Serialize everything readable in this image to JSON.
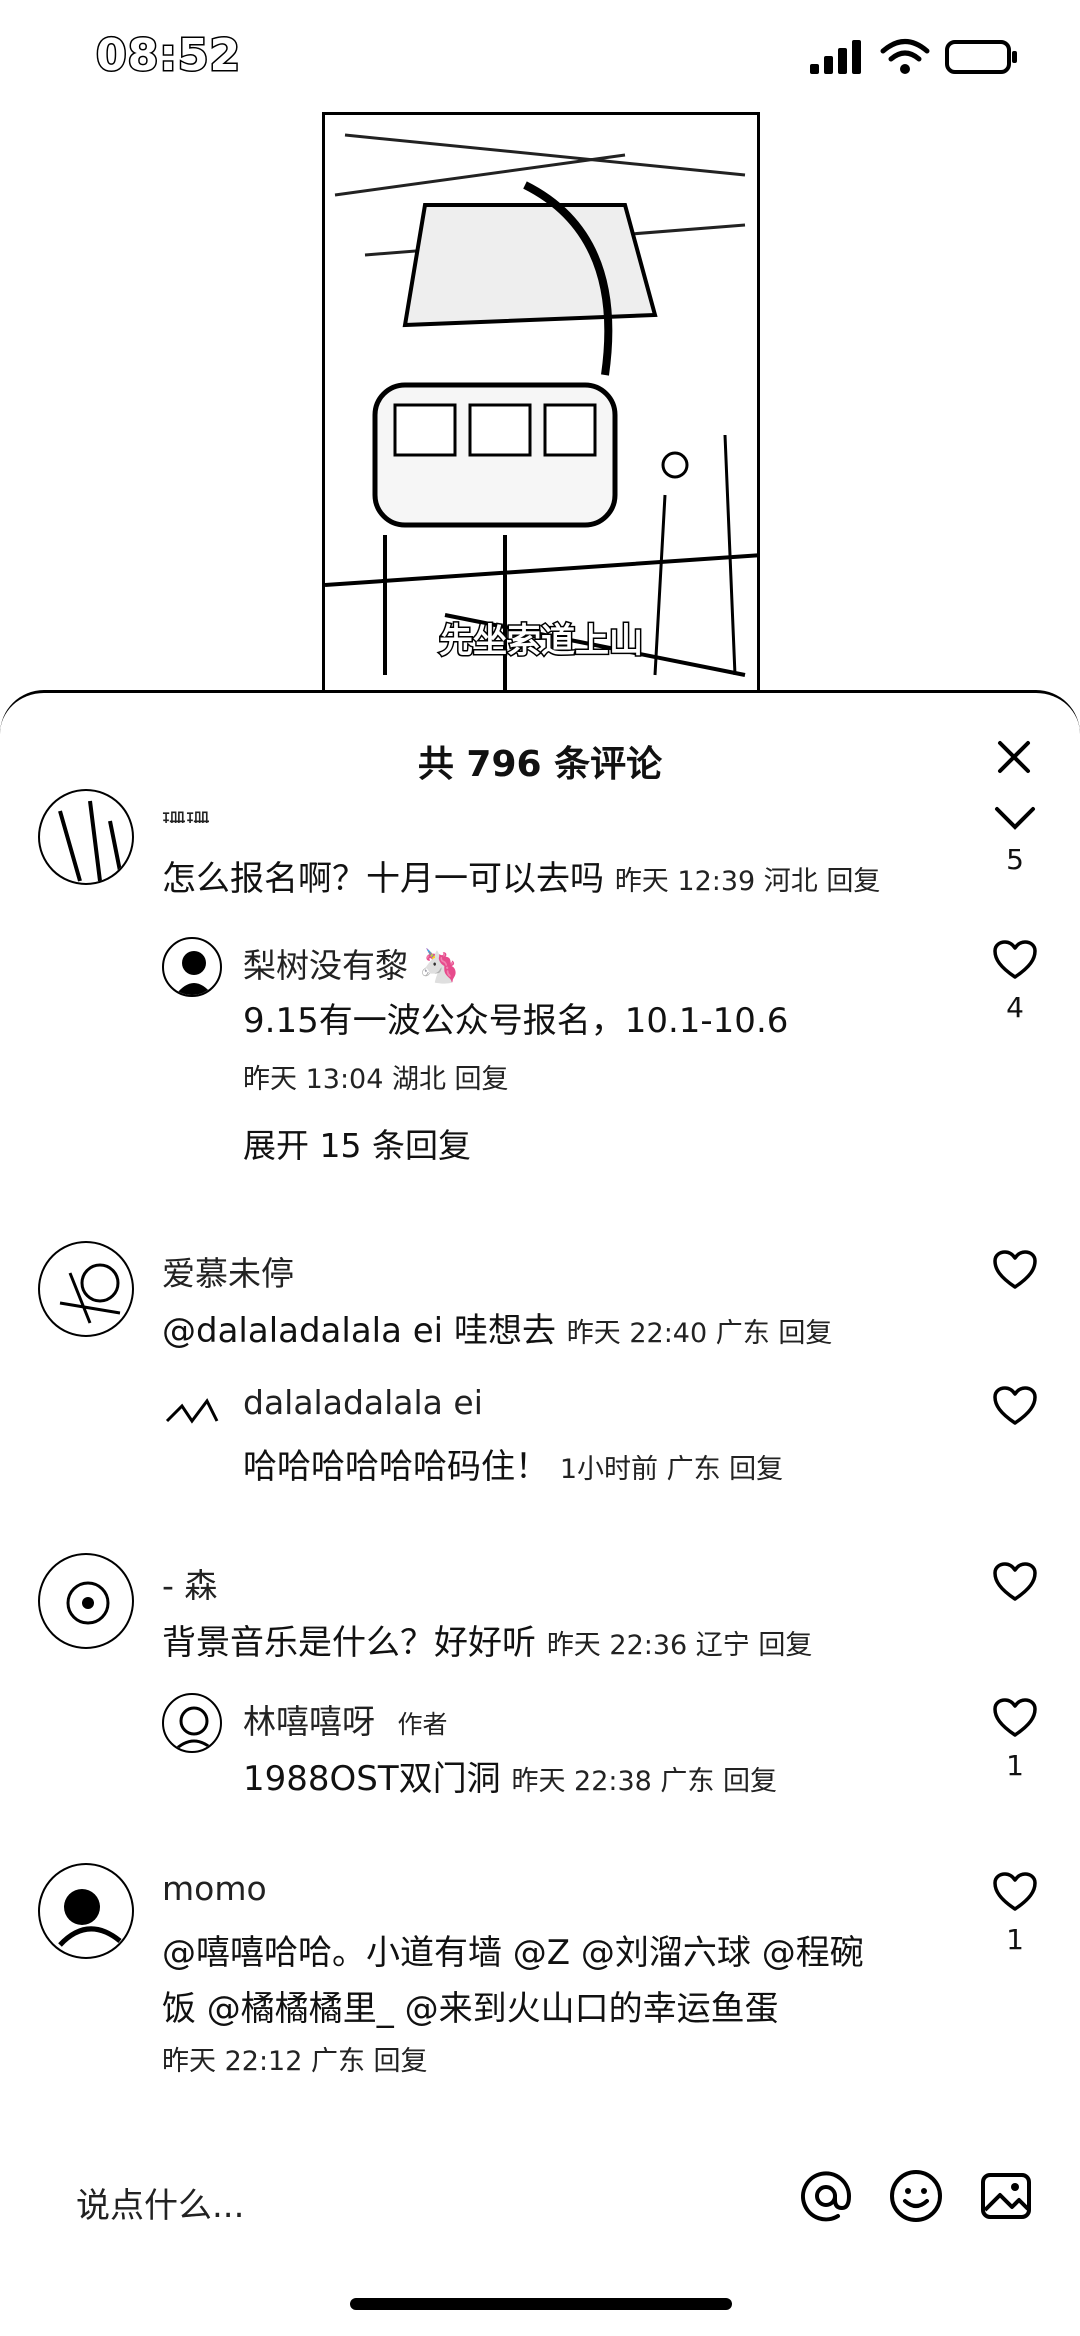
{
  "status_bar": {
    "time": "08:52",
    "icons": [
      "signal-icon",
      "wifi-icon",
      "battery-icon"
    ]
  },
  "video": {
    "caption": "先坐索道上山"
  },
  "sheet": {
    "title": "共 796 条评论",
    "close_icon": "close-icon"
  },
  "comments": [
    {
      "name": "珊珊",
      "text": "怎么报名啊？十月一可以去吗",
      "meta": "昨天 12:39 河北 回复",
      "likes": "5",
      "like_icon": "chevron-down-icon",
      "replies": [
        {
          "name": "梨树没有黎 🦄",
          "text": "9.15有一波公众号报名，10.1-10.6",
          "meta": "昨天 13:04 湖北 回复",
          "likes": "4"
        }
      ],
      "expand": "展开 15 条回复"
    },
    {
      "name": "爱慕未停",
      "text": "@dalaladalala ei 哇想去",
      "meta": "昨天 22:40 广东 回复",
      "likes": "",
      "replies": [
        {
          "name": "dalaladalala ei",
          "text": "哈哈哈哈哈哈码住！",
          "meta": "1小时前 广东 回复",
          "likes": ""
        }
      ]
    },
    {
      "name": "- 森",
      "text": "背景音乐是什么？好好听",
      "meta": "昨天 22:36 辽宁 回复",
      "likes": "",
      "replies": [
        {
          "name": "林嘻嘻呀",
          "tag": "作者",
          "text": "1988OST双门洞",
          "meta": "昨天 22:38 广东 回复",
          "likes": "1"
        }
      ]
    },
    {
      "name": "momo",
      "text_line1": "@嘻嘻哈哈。小道有墙 @Z @刘溜六球 @程碗",
      "text_line2": "饭 @橘橘橘里_ @来到火山口的幸运鱼蛋",
      "meta": "昨天 22:12 广东 回复",
      "likes": "1"
    }
  ],
  "input": {
    "placeholder": "说点什么...",
    "icons": [
      "at-icon",
      "emoji-icon",
      "image-icon"
    ]
  }
}
